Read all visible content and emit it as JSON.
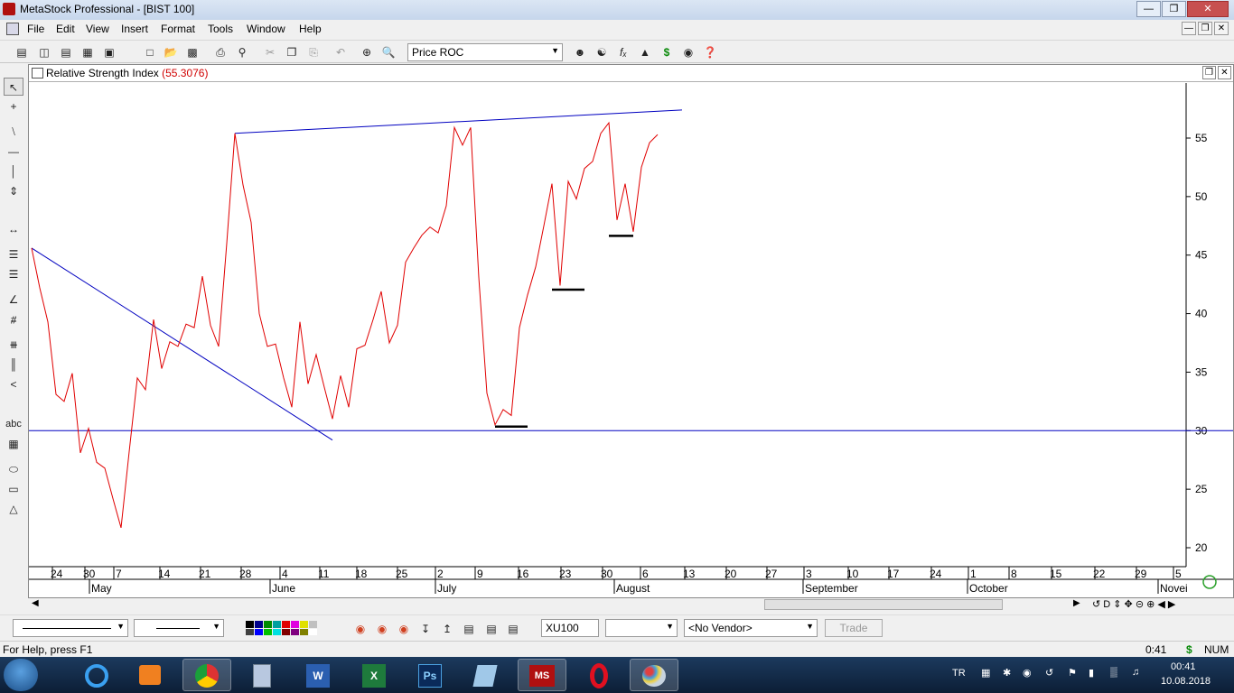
{
  "window": {
    "title": "MetaStock Professional - [BIST 100]",
    "minimize": "0",
    "maximize": "1",
    "close": "r"
  },
  "menu": [
    "File",
    "Edit",
    "View",
    "Insert",
    "Format",
    "Tools",
    "Window",
    "Help"
  ],
  "toolbar": {
    "indicator_select": "Price ROC"
  },
  "chart": {
    "panel_title": "Relative Strength Index",
    "panel_value": "(55.3076)",
    "y_ticks": [
      "55",
      "50",
      "45",
      "40",
      "35",
      "30",
      "25",
      "20"
    ],
    "day_ticks": [
      "24",
      "30",
      "7",
      "14",
      "21",
      "28",
      "4",
      "11",
      "18",
      "25",
      "2",
      "9",
      "16",
      "23",
      "30",
      "6",
      "13",
      "20",
      "27",
      "3",
      "10",
      "17",
      "24",
      "1",
      "8",
      "15",
      "22",
      "29",
      "5"
    ],
    "month_labels": [
      "May",
      "June",
      "July",
      "August",
      "September",
      "October",
      "Novei"
    ]
  },
  "chart_data": {
    "type": "line",
    "title": "Relative Strength Index",
    "ylim": [
      19,
      58
    ],
    "series": [
      {
        "name": "Relative Strength Index",
        "color": "#e00000",
        "values": [
          45.6,
          42.2,
          39.3,
          33.1,
          32.5,
          34.9,
          28.1,
          30.2,
          27.3,
          26.8,
          24.2,
          21.7,
          28.2,
          34.5,
          33.5,
          39.5,
          35.3,
          37.6,
          37.2,
          39.1,
          38.8,
          43.2,
          39.0,
          37.2,
          46.0,
          55.4,
          51.0,
          47.8,
          40.0,
          37.2,
          37.4,
          34.5,
          32.0,
          39.3,
          34.0,
          36.5,
          33.7,
          31.0,
          34.7,
          32.0,
          37.0,
          37.3,
          39.5,
          41.9,
          37.5,
          39.0,
          44.4,
          45.6,
          46.7,
          47.4,
          46.9,
          49.2,
          55.9,
          54.4,
          55.9,
          43.1,
          33.2,
          30.5,
          31.8,
          31.3,
          38.8,
          41.6,
          44.0,
          47.5,
          51.1,
          42.4,
          51.3,
          49.8,
          52.4,
          53.0,
          55.4,
          56.3,
          48.0,
          51.1,
          47.0,
          52.5,
          54.6,
          55.3
        ]
      },
      {
        "name": "Resistance trendline",
        "color": "#0000c0",
        "points": [
          [
            25,
            55.4
          ],
          [
            80,
            57.4
          ]
        ]
      },
      {
        "name": "Descending trendline",
        "color": "#0000c0",
        "points": [
          [
            0,
            45.6
          ],
          [
            37,
            29.2
          ]
        ]
      },
      {
        "name": "Horizontal line",
        "color": "#0000c0",
        "level": 30
      },
      {
        "name": "Support marks",
        "color": "#000000",
        "segments": [
          [
            57,
            61,
            30.5
          ],
          [
            64,
            68,
            42.2
          ],
          [
            71,
            74,
            46.8
          ]
        ]
      }
    ]
  },
  "bottom": {
    "symbol": "XU100",
    "vendor": "<No Vendor>",
    "trade": "Trade"
  },
  "status": {
    "help": "For Help, press F1",
    "time": "0:41",
    "currency": "$",
    "num": "NUM"
  },
  "taskbar": {
    "lang": "TR",
    "clock": "00:41",
    "date": "10.08.2018"
  }
}
